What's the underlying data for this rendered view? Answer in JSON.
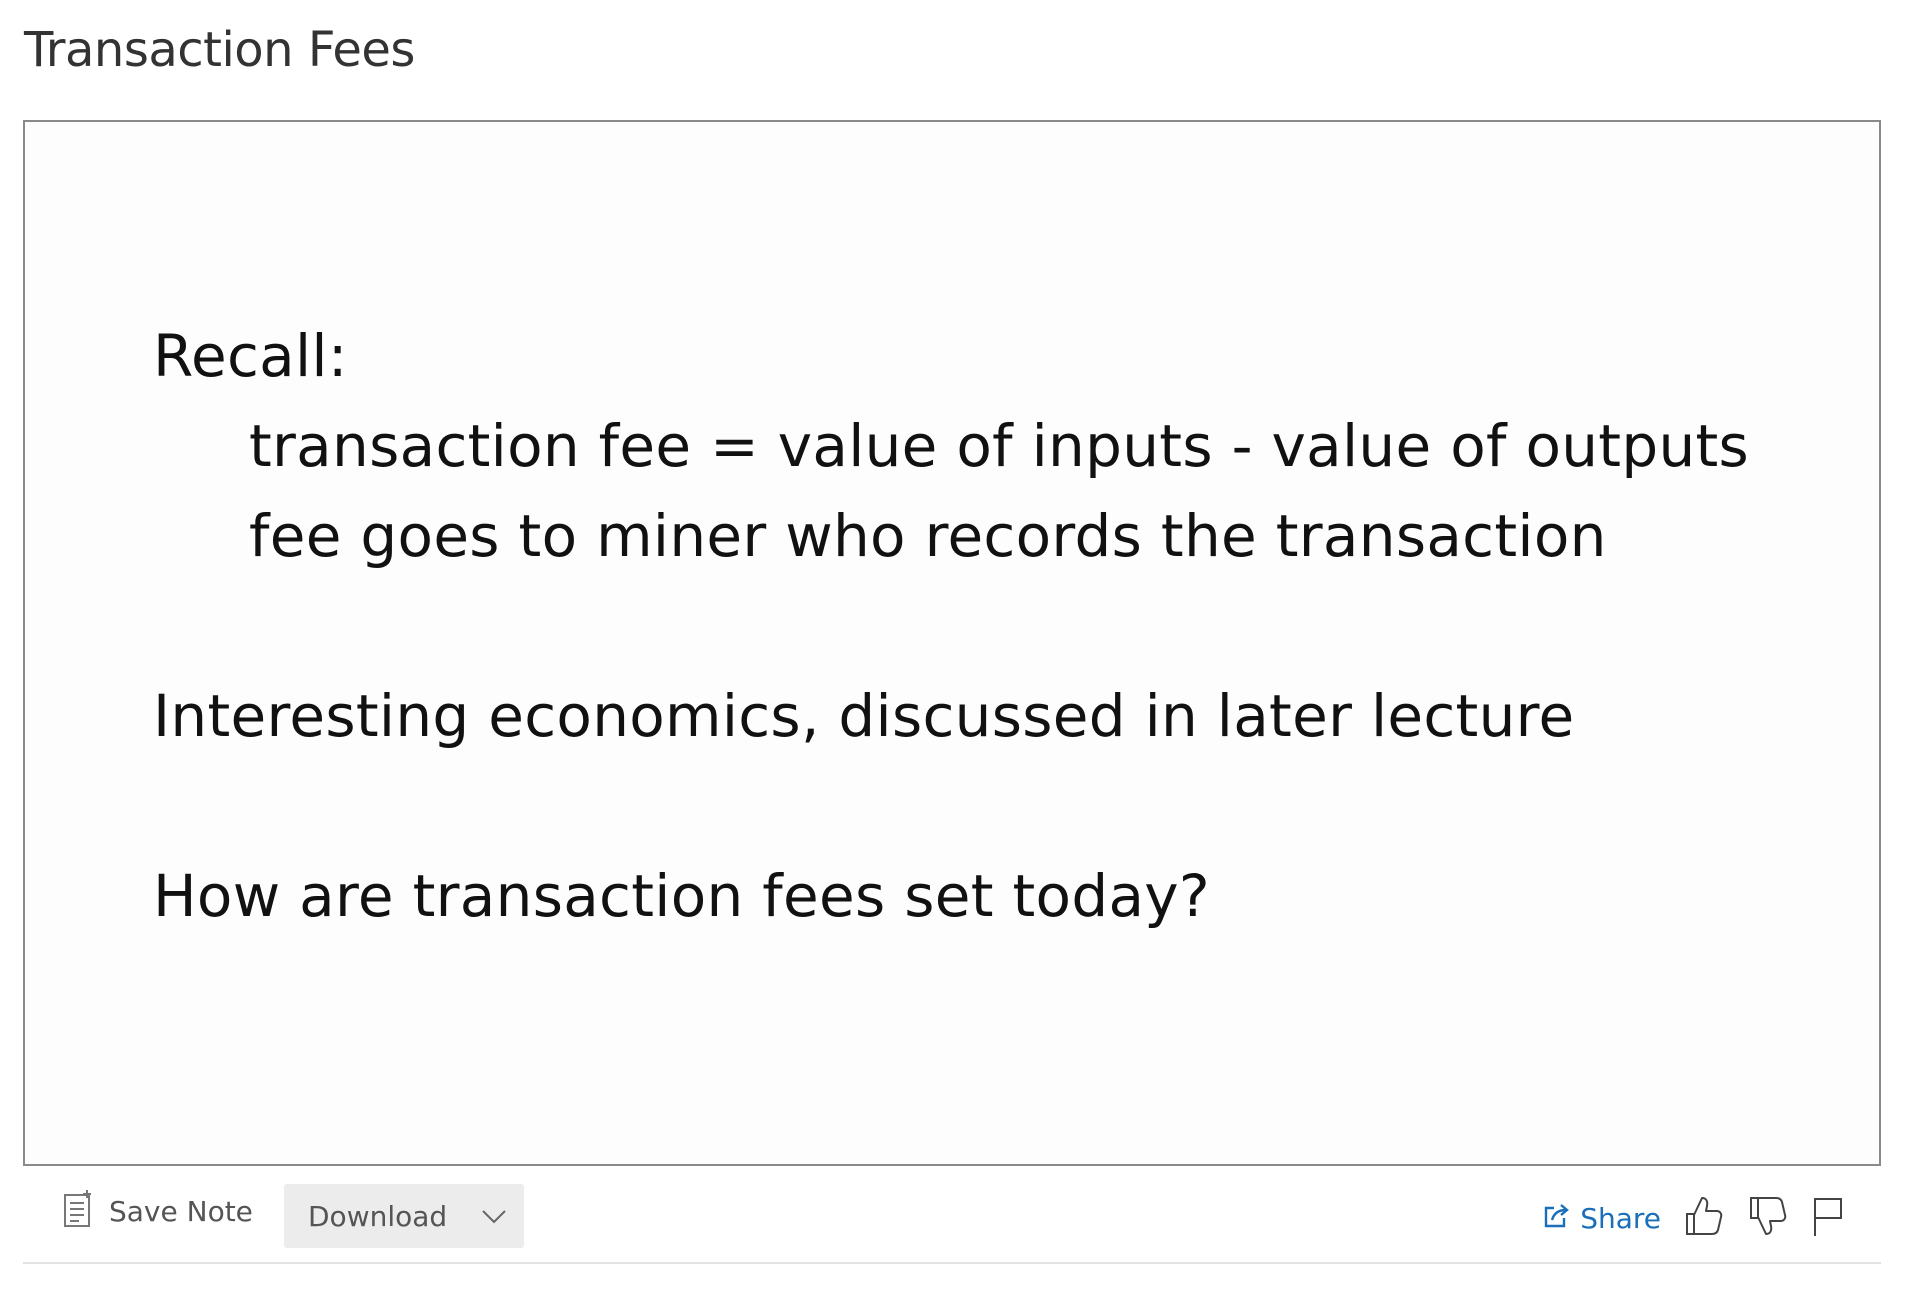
{
  "page": {
    "title": "Transaction Fees"
  },
  "slide": {
    "lines": [
      "Recall:",
      "transaction fee = value of inputs - value of outputs",
      "fee goes to miner who records the transaction",
      "Interesting economics, discussed in later lecture",
      "How are transaction fees set today?"
    ]
  },
  "toolbar": {
    "save_note_label": "Save Note",
    "download_label": "Download",
    "share_label": "Share",
    "icons": {
      "save_note": "note-icon",
      "download_dropdown": "chevron-down-icon",
      "share": "share-icon",
      "like": "thumbs-up-icon",
      "dislike": "thumbs-down-icon",
      "flag": "flag-icon"
    },
    "colors": {
      "share_accent": "#1a6fb8",
      "download_bg": "#ececec"
    }
  }
}
